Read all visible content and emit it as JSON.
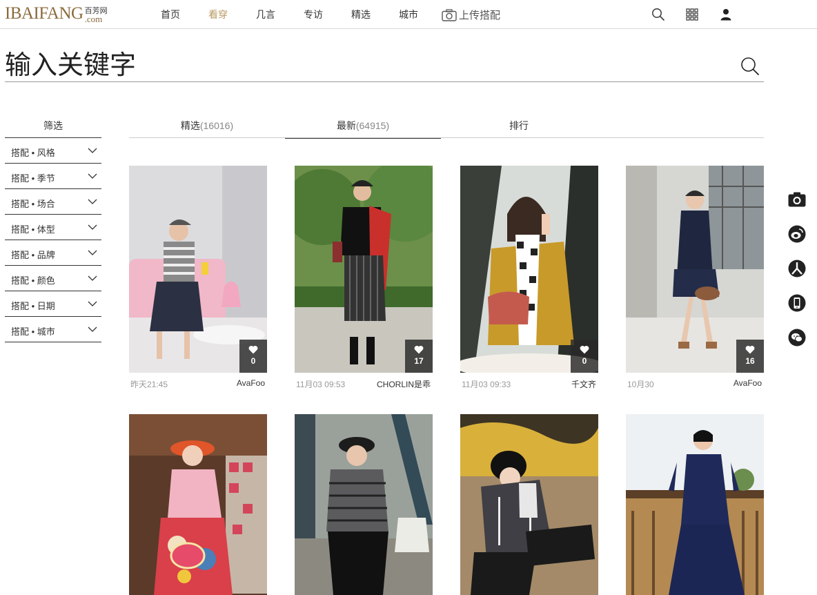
{
  "header": {
    "logo_main": "IBAIFANG",
    "logo_cn": "百芳网",
    "logo_com": ".com",
    "nav": [
      {
        "label": "首页",
        "active": false
      },
      {
        "label": "看穿",
        "active": true
      },
      {
        "label": "几言",
        "active": false
      },
      {
        "label": "专访",
        "active": false
      },
      {
        "label": "精选",
        "active": false
      },
      {
        "label": "城市",
        "active": false
      }
    ],
    "upload_label": "上传搭配",
    "icons": [
      "search-icon",
      "grid-icon",
      "user-icon"
    ]
  },
  "search": {
    "placeholder": "输入关键字",
    "button_icon": "search-icon"
  },
  "filter": {
    "title": "筛选",
    "items": [
      "搭配 • 风格",
      "搭配 • 季节",
      "搭配 • 场合",
      "搭配 • 体型",
      "搭配 • 品牌",
      "搭配 • 颜色",
      "搭配 • 日期",
      "搭配 • 城市"
    ]
  },
  "tabs": [
    {
      "label": "精选",
      "count": "(16016)",
      "active": false
    },
    {
      "label": "最新",
      "count": "(64915)",
      "active": true
    },
    {
      "label": "排行",
      "count": "",
      "active": false
    }
  ],
  "cards": [
    {
      "time": "昨天21:45",
      "author": "AvaFoo",
      "likes": "0"
    },
    {
      "time": "11月03 09:53",
      "author": "CHORLIN是乖",
      "likes": "17"
    },
    {
      "time": "11月03 09:33",
      "author": "千文齐",
      "likes": "0"
    },
    {
      "time": "10月30",
      "author": "AvaFoo",
      "likes": "16"
    },
    {
      "time": "",
      "author": "",
      "likes": ""
    },
    {
      "time": "",
      "author": "",
      "likes": ""
    },
    {
      "time": "",
      "author": "",
      "likes": ""
    },
    {
      "time": "",
      "author": "",
      "likes": ""
    }
  ],
  "share_icons": [
    "camera-icon",
    "weibo-icon",
    "renren-icon",
    "mobile-icon",
    "wechat-icon"
  ],
  "colors": {
    "accent": "#b99a62",
    "logo": "#8a6b3c",
    "like_overlay": "#2b2b2b"
  }
}
